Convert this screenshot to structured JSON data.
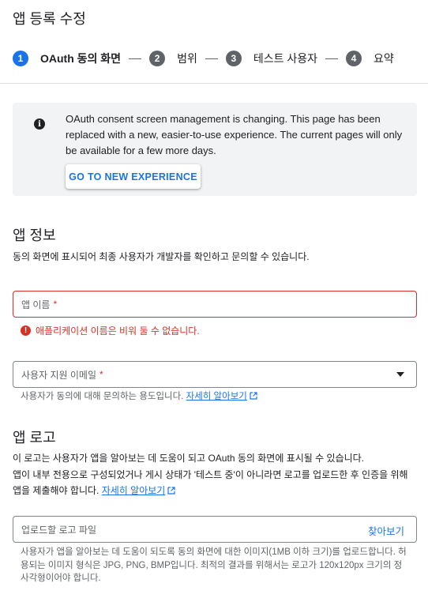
{
  "page_title": "앱 등록 수정",
  "stepper": [
    {
      "num": "1",
      "label": "OAuth 동의 화면"
    },
    {
      "num": "2",
      "label": "범위"
    },
    {
      "num": "3",
      "label": "테스트 사용자"
    },
    {
      "num": "4",
      "label": "요약"
    }
  ],
  "banner": {
    "icon": "info-icon",
    "text": "OAuth consent screen management is changing. This page has been replaced with a new, easier-to-use experience. The current pages will only be available for a few more days.",
    "button": "GO TO NEW EXPERIENCE"
  },
  "app_info": {
    "title": "앱 정보",
    "desc": "동의 화면에 표시되어 최종 사용자가 개발자를 확인하고 문의할 수 있습니다.",
    "app_name_label": "앱 이름",
    "required_mark": "*",
    "app_name_error": "애플리케이션 이름은 비워 둘 수 없습니다.",
    "support_email_label": "사용자 지원 이메일",
    "support_email_helper": "사용자가 동의에 대해 문의하는 용도입니다.",
    "learn_more": "자세히 알아보기"
  },
  "app_logo": {
    "title": "앱 로고",
    "desc_line1": "이 로고는 사용자가 앱을 알아보는 데 도움이 되고 OAuth 동의 화면에 표시될 수 있습니다.",
    "desc_line2": "앱이 내부 전용으로 구성되었거나 게시 상태가 '테스트 중'이 아니라면 로고를 업로드한 후 인증을 위해",
    "desc_line3": "앱을 제출해야 합니다.",
    "learn_more": "자세히 알아보기",
    "upload_placeholder": "업로드할 로고 파일",
    "browse": "찾아보기",
    "helper_line1": "사용자가 앱을 알아보는 데 도움이 되도록 동의 화면에 대한 이미지(1MB 이하 크기)를 업로드합니다. 허",
    "helper_line2": "용되는 이미지 형식은 JPG, PNG, BMP입니다. 최적의 결과를 위해서는 로고가 120x120px 크기의 정",
    "helper_line3": "사각형이어야 합니다."
  },
  "colors": {
    "accent": "#1a73e8",
    "error": "#d93025",
    "banner_bg": "#f1f3f4"
  }
}
